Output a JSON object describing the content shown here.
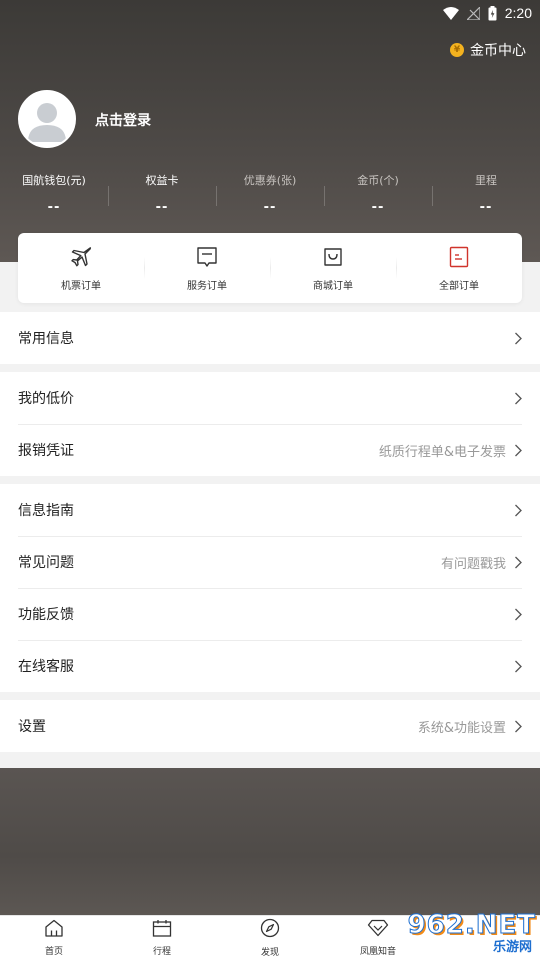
{
  "status_bar": {
    "time": "2:20"
  },
  "header": {
    "coin_center_label": "金币中心",
    "login_label": "点击登录"
  },
  "stats": [
    {
      "label": "国航钱包(元)",
      "value": "--"
    },
    {
      "label": "权益卡",
      "value": "--"
    },
    {
      "label": "优惠券(张)",
      "value": "--"
    },
    {
      "label": "金币(个)",
      "value": "--"
    },
    {
      "label": "里程",
      "value": "--"
    }
  ],
  "orders": [
    {
      "label": "机票订单",
      "icon": "plane-icon"
    },
    {
      "label": "服务订单",
      "icon": "service-icon"
    },
    {
      "label": "商城订单",
      "icon": "shopping-bag-icon"
    },
    {
      "label": "全部订单",
      "icon": "all-orders-icon"
    }
  ],
  "menu": {
    "common_info": "常用信息",
    "my_low_price": "我的低价",
    "reimbursement": {
      "label": "报销凭证",
      "hint": "纸质行程单&电子发票"
    },
    "info_guide": "信息指南",
    "faq": {
      "label": "常见问题",
      "hint": "有问题戳我"
    },
    "feedback": "功能反馈",
    "online_service": "在线客服",
    "settings": {
      "label": "设置",
      "hint": "系统&功能设置"
    }
  },
  "tabbar": [
    {
      "label": "首页",
      "icon": "home-icon"
    },
    {
      "label": "行程",
      "icon": "calendar-icon"
    },
    {
      "label": "发现",
      "icon": "compass-icon"
    },
    {
      "label": "凤凰知音",
      "icon": "diamond-icon"
    }
  ],
  "watermark": {
    "main": "962.NET",
    "sub": "乐游网"
  },
  "colors": {
    "accent": "#d0342c",
    "coin": "#f3b21f",
    "header_dark": "#3c3a37"
  }
}
